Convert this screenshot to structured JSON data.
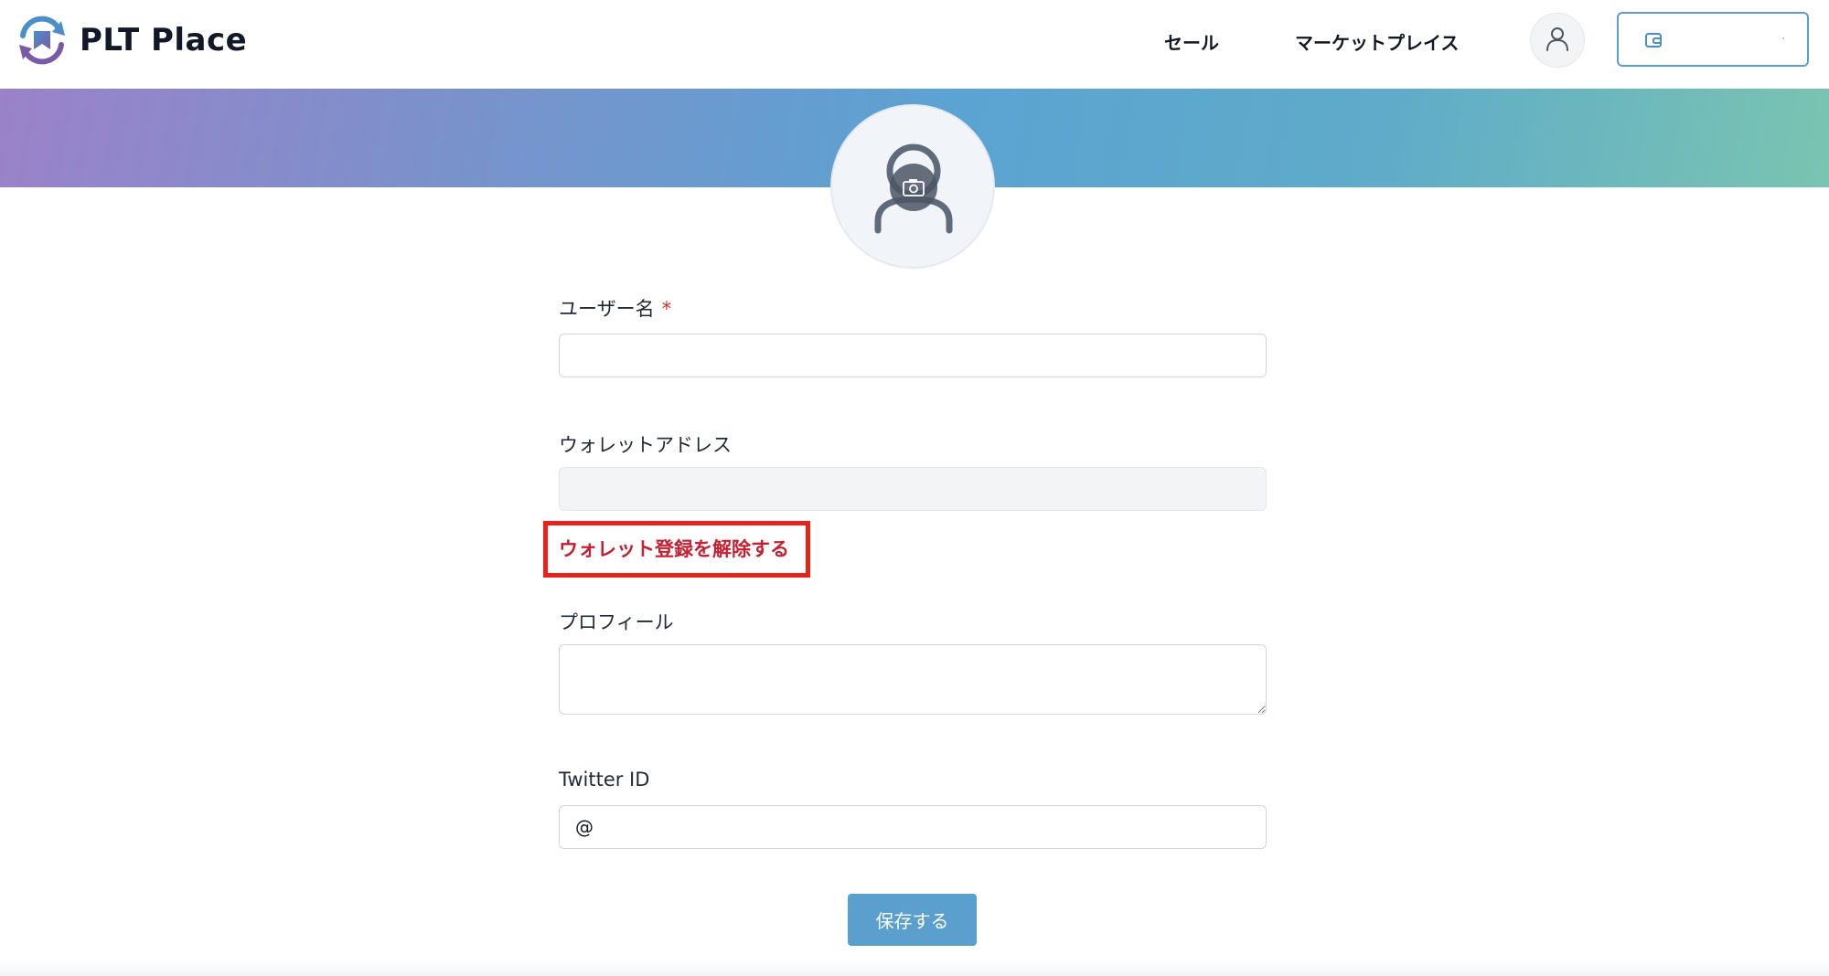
{
  "brand": {
    "name": "PLT Place",
    "colors": {
      "purple": "#7a5aa8",
      "blue": "#4a8fc9",
      "accent": "#5b9fcf"
    }
  },
  "nav": {
    "sale": "セール",
    "marketplace": "マーケットプレイス"
  },
  "icons": {
    "logo": "plt-place-logo",
    "user": "user-icon",
    "wallet": "wallet-icon",
    "camera": "camera-icon"
  },
  "form": {
    "username": {
      "label": "ユーザー名",
      "required_mark": "*",
      "value": ""
    },
    "wallet_address": {
      "label": "ウォレットアドレス",
      "value": ""
    },
    "unregister_wallet": "ウォレット登録を解除する",
    "profile": {
      "label": "プロフィール",
      "value": ""
    },
    "twitter": {
      "label": "Twitter ID",
      "prefix": "@",
      "value": ""
    },
    "save_label": "保存する"
  },
  "colors": {
    "highlight_border": "#e8231b",
    "danger_text": "#c81e2f",
    "required": "#dc2626",
    "button": "#5b9fcf"
  }
}
